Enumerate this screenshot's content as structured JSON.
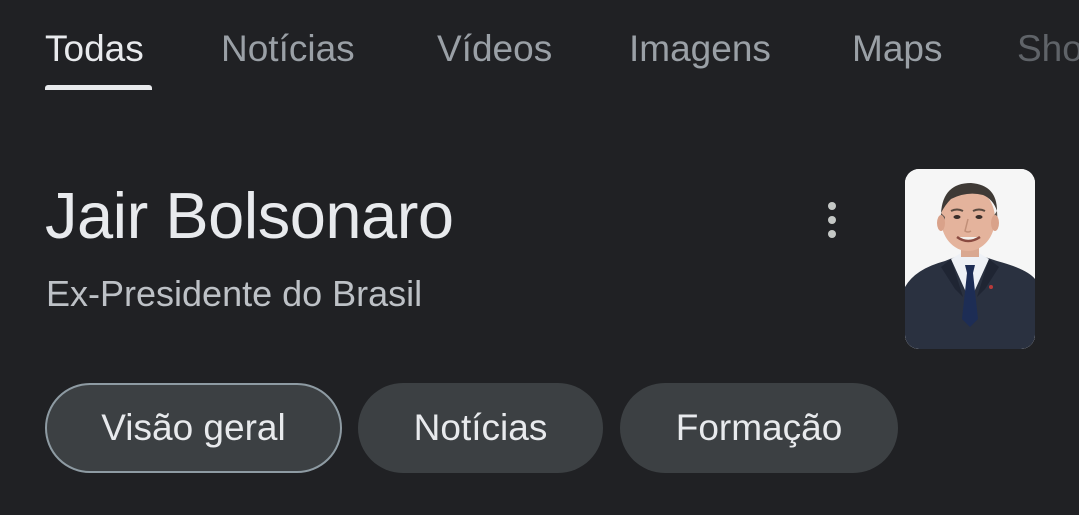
{
  "tabs": [
    {
      "label": "Todas"
    },
    {
      "label": "Notícias"
    },
    {
      "label": "Vídeos"
    },
    {
      "label": "Imagens"
    },
    {
      "label": "Maps"
    },
    {
      "label": "Sho"
    }
  ],
  "entity": {
    "title": "Jair Bolsonaro",
    "subtitle": "Ex-Presidente do Brasil",
    "more_icon": "more-vert-icon",
    "image": "portrait-photo"
  },
  "chips": [
    {
      "label": "Visão geral"
    },
    {
      "label": "Notícias"
    },
    {
      "label": "Formação"
    }
  ],
  "colors": {
    "background": "#202124",
    "text_primary": "#e8eaed",
    "text_secondary": "#9aa0a6",
    "chip_background": "#3c4043",
    "chip_selected_border": "#8e9ba3"
  }
}
